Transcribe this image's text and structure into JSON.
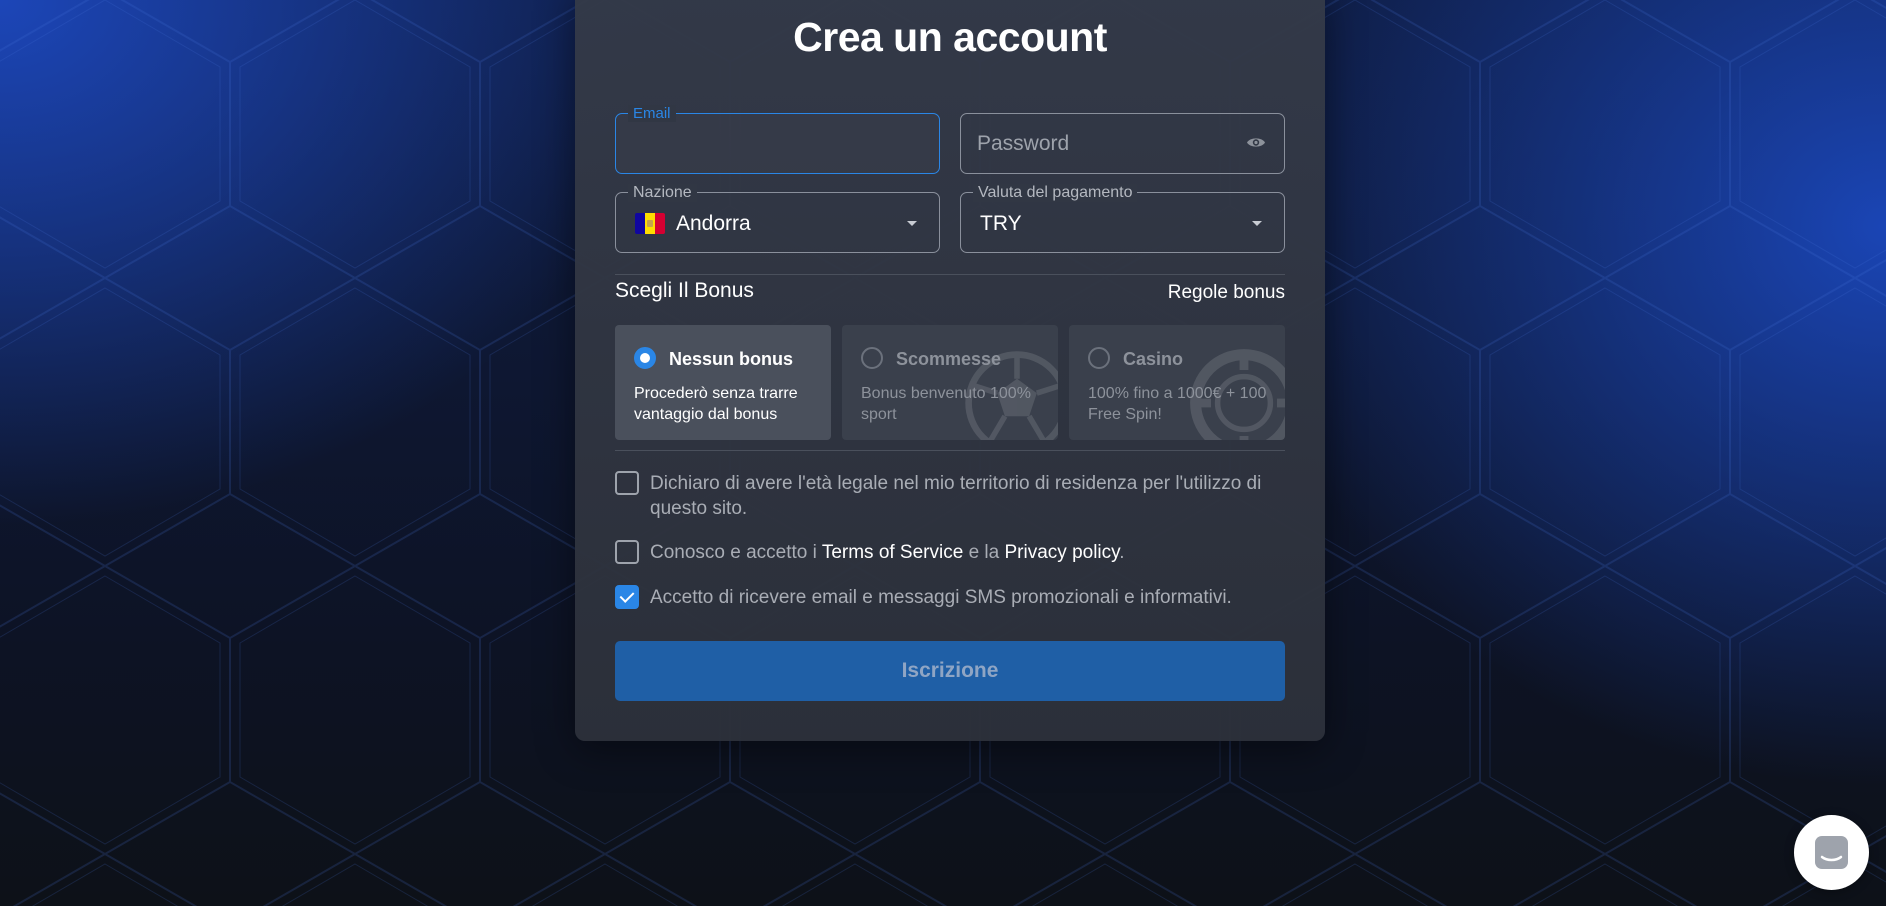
{
  "form": {
    "title": "Crea un account",
    "email": {
      "label": "Email",
      "value": ""
    },
    "password": {
      "placeholder": "Password",
      "toggle_icon": "eye-icon"
    },
    "country": {
      "label": "Nazione",
      "value": "Andorra",
      "flag_colors": [
        "#10069f",
        "#fedd00",
        "#d50032"
      ]
    },
    "currency": {
      "label": "Valuta del pagamento",
      "value": "TRY"
    },
    "bonus_section": {
      "title": "Scegli Il Bonus",
      "rules_link": "Regole bonus",
      "options": [
        {
          "name": "Nessun bonus",
          "description": "Procederò senza trarre vantaggio dal bonus",
          "selected": true
        },
        {
          "name": "Scommesse",
          "description": "Bonus benvenuto 100% sport",
          "selected": false,
          "watermark_icon": "soccer-ball-icon"
        },
        {
          "name": "Casino",
          "description": "100% fino a 1000€ + 100 Free Spin!",
          "selected": false,
          "watermark_icon": "casino-chip-icon"
        }
      ]
    },
    "checks": {
      "age": {
        "text": "Dichiaro di avere l'età legale nel mio territorio di residenza per l'utilizzo di questo sito.",
        "checked": false
      },
      "terms": {
        "prefix": "Conosco e accetto i ",
        "terms_link": "Terms of Service",
        "middle": " e la ",
        "privacy_link": "Privacy policy",
        "suffix": ".",
        "checked": false
      },
      "marketing": {
        "text": "Accetto di ricevere email e messaggi SMS promozionali e informativi.",
        "checked": true
      }
    },
    "submit_label": "Iscrizione"
  },
  "colors": {
    "accent": "#2a86e6",
    "submit_bg": "#1f5fa6"
  },
  "chat_widget": {
    "icon": "chat-icon"
  }
}
